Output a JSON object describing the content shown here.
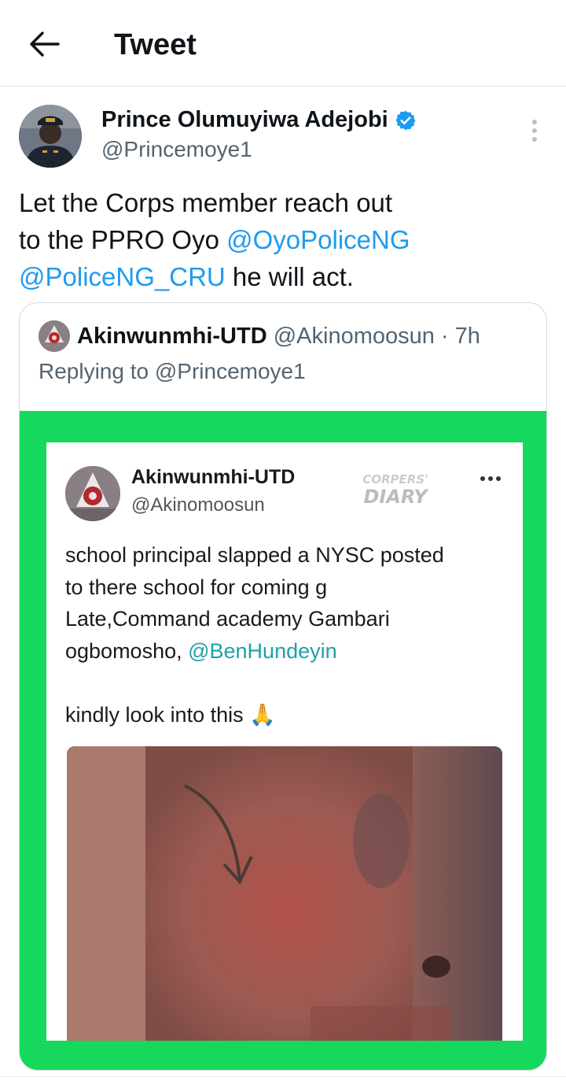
{
  "header": {
    "title": "Tweet"
  },
  "tweet": {
    "author_name": "Prince Olumuyiwa Adejobi",
    "author_handle": "@Princemoye1",
    "text_line1": "Let the Corps member reach out",
    "text_line2_prefix": "to the PPRO Oyo ",
    "mention1": "@OyoPoliceNG",
    "mention2": "@PoliceNG_CRU",
    "text_suffix": " he will act."
  },
  "quote": {
    "author_name": "Akinwunmhi-UTD",
    "author_handle_time": "@Akinomoosun · 7h",
    "replying_to": "Replying to @Princemoye1"
  },
  "screenshot": {
    "author_name": "Akinwunmhi-UTD",
    "author_handle": "@Akinomoosun",
    "watermark_line1": "CORPERS'",
    "watermark_line2": "DIARY",
    "body_line1": "school principal slapped a NYSC  posted",
    "body_line2": "to there school for coming g",
    "body_line3": "Late,Command academy Gambari",
    "body_line4_prefix": "ogbomosho, ",
    "body_mention": "@BenHundeyin",
    "body_line5": "kindly look into this",
    "body_emoji": "🙏"
  },
  "colors": {
    "accent": "#1d9bf0",
    "media_background": "#16d85d",
    "verified": "#1d9bf0"
  },
  "icons": [
    "back-arrow-icon",
    "verified-badge-icon",
    "more-vertical-icon",
    "more-horizontal-icon"
  ]
}
